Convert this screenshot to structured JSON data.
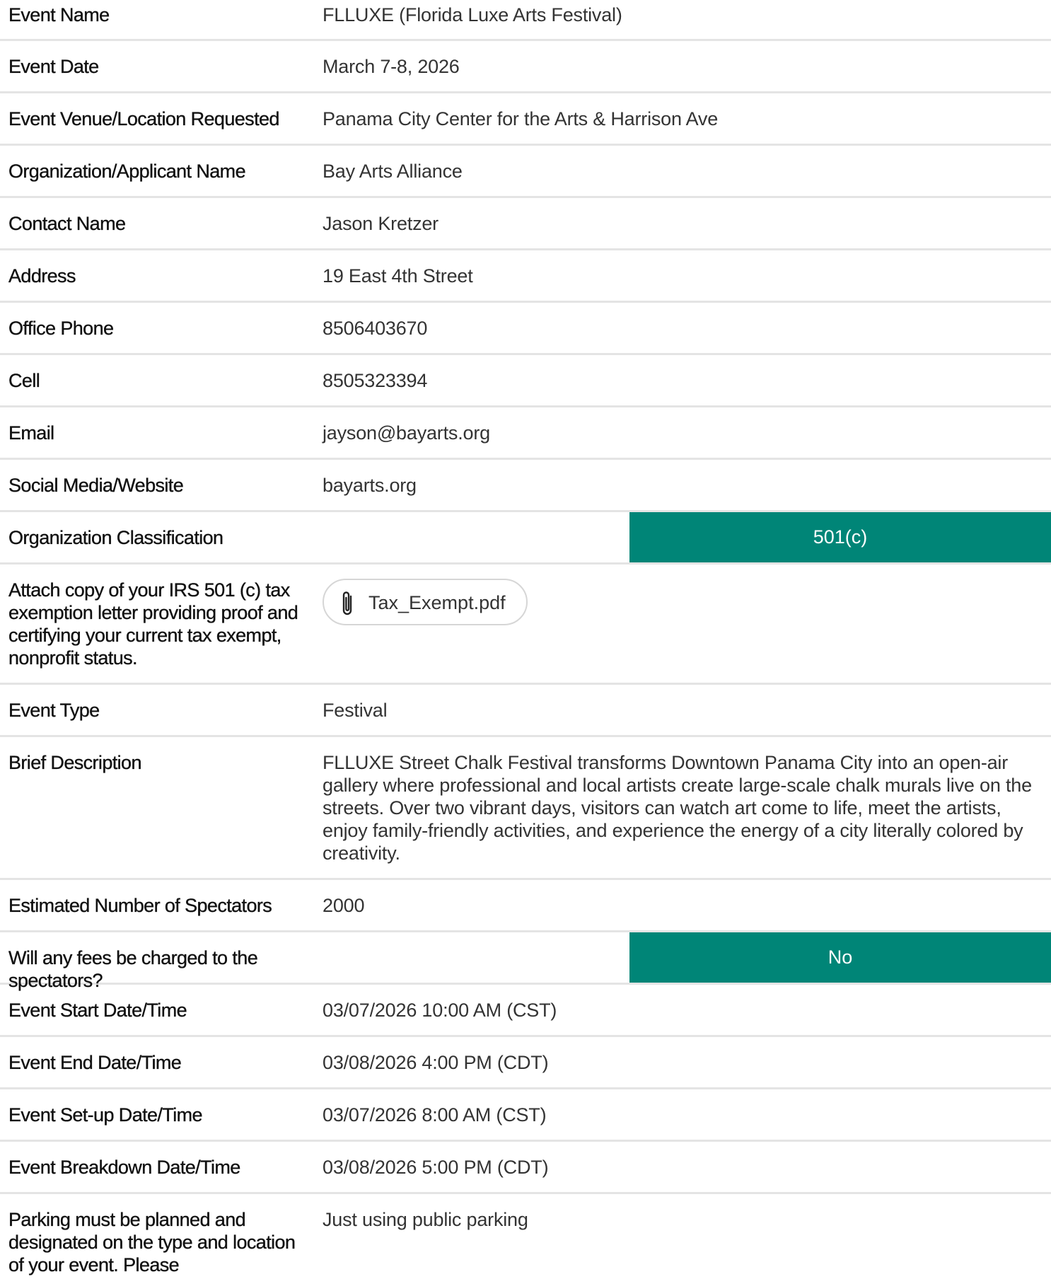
{
  "colors": {
    "accent": "#008577",
    "divider": "#e4e4e4"
  },
  "rows": [
    {
      "label": "Event Name",
      "value": "FLLUXE (Florida Luxe Arts Festival)"
    },
    {
      "label": "Event Date",
      "value": "March 7-8, 2026"
    },
    {
      "label": "Event Venue/Location Requested",
      "value": "Panama City Center for the Arts & Harrison Ave"
    },
    {
      "label": "Organization/Applicant Name",
      "value": "Bay Arts Alliance"
    },
    {
      "label": "Contact Name",
      "value": "Jason Kretzer"
    },
    {
      "label": "Address",
      "value": "19 East 4th Street"
    },
    {
      "label": "Office Phone",
      "value": "8506403670"
    },
    {
      "label": "Cell",
      "value": "8505323394"
    },
    {
      "label": "Email",
      "value": "jayson@bayarts.org"
    },
    {
      "label": "Social Media/Website",
      "value": "bayarts.org"
    },
    {
      "label": "Organization Classification",
      "value": "501(c)"
    },
    {
      "label": "Attach copy of your IRS 501 (c) tax exemption letter providing proof and certifying your current tax exempt, nonprofit status.",
      "value": "Tax_Exempt.pdf",
      "icon": "paperclip-icon"
    },
    {
      "label": "Event Type",
      "value": "Festival"
    },
    {
      "label": "Brief Description",
      "value": "FLLUXE Street Chalk Festival transforms Downtown Panama City into an open-air gallery where professional and local artists create large-scale chalk murals live on the streets. Over two vibrant days, visitors can watch art come to life, meet the artists, enjoy family-friendly activities, and experience the energy of a city literally colored by creativity."
    },
    {
      "label": "Estimated Number of Spectators",
      "value": "2000"
    },
    {
      "label": "Will any fees be charged to the spectators?",
      "value": "No"
    },
    {
      "label": "Event Start Date/Time",
      "value": "03/07/2026 10:00 AM (CST)"
    },
    {
      "label": "Event End Date/Time",
      "value": "03/08/2026 4:00 PM (CDT)"
    },
    {
      "label": "Event Set-up Date/Time",
      "value": "03/07/2026 8:00 AM (CST)"
    },
    {
      "label": "Event Breakdown Date/Time",
      "value": "03/08/2026 5:00 PM (CDT)"
    },
    {
      "label": "Parking must be planned and designated on the type and location of your event. Please",
      "value": "Just using public parking"
    }
  ]
}
